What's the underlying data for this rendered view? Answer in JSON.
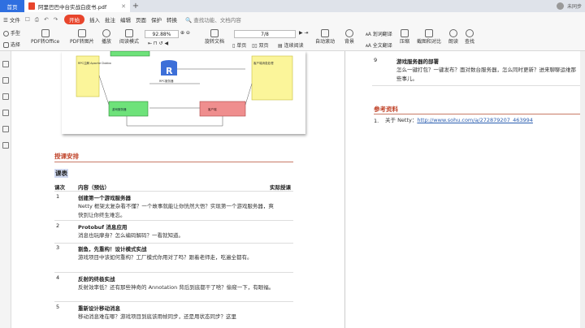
{
  "tabs": {
    "home_label": "首页",
    "doc_label": "阿里巴巴中台实战白皮书.pdf",
    "add_label": "+",
    "right_label": "未同步"
  },
  "menu": {
    "file_label": "文件",
    "quick_access": "☐ ⎙ ↶ ↷",
    "items": [
      "开始",
      "插入",
      "批注",
      "编辑",
      "页面",
      "保护",
      "转换"
    ],
    "search_placeholder": "查找功能、文档内容"
  },
  "toolbar": {
    "hand_label": "手型",
    "select_label": "选择",
    "pdf_to_office_label": "PDF转Office",
    "pdf_to_image_label": "PDF转图片",
    "play_label": "播放",
    "read_mode_label": "阅读模式",
    "zoom_value": "92.88%",
    "page_value": "7/8",
    "rotate_label": "旋转文档",
    "single_label": "单页",
    "double_label": "双页",
    "continuous_label": "连续阅读",
    "auto_scroll_label": "自动滚动",
    "background_label": "背景",
    "translate_label": "划词翻译",
    "full_translate_label": "全文翻译",
    "compress_label": "压缩",
    "screenshot_label": "截图和对比",
    "read_label": "朗读",
    "find_label": "查找"
  },
  "diagram": {
    "labels": [
      "RPC服务器",
      "游戏服务器",
      "RPC服务器",
      "客户端"
    ],
    "notes": [
      "RPC注解 Apache Dubbo",
      "客户端消息处理"
    ]
  },
  "left_page": {
    "section_title": "授课安排",
    "table_label": "课表",
    "headers": [
      "课次",
      "内容（预估）",
      "实际授课"
    ],
    "rows": [
      {
        "num": "1",
        "title": "创建第一个游戏服务器",
        "desc": "Netty 框架太复杂看不懂？一个故事就能让你恍然大悟？实现第一个游戏服务器，爽快到让你终生难忘。"
      },
      {
        "num": "2",
        "title": "Protobuf 消息应用",
        "desc": "消息也玩摩身？怎么编码解码？一看就知道。"
      },
      {
        "num": "3",
        "title": "割鱼，先重构！设计模式实战",
        "desc": "游戏项目中该如何重构？工厂模式你用对了吗？跟着老师走，吃遍全都有。"
      },
      {
        "num": "4",
        "title": "反射的终极实战",
        "desc": "反射效率低？还有那些神奇的 Annotation 背后到底都干了啥？偷窥一下，有眼福。"
      },
      {
        "num": "5",
        "title": "重新设计移动消息",
        "desc": "移动消息难在哪？游戏项目到底该用帧同步，还是用状态同步？这里"
      }
    ]
  },
  "right_page": {
    "row_num": "9",
    "row_title": "游戏服务器的部署",
    "row_desc": "怎么一键打包？一键发布？面对数台服务器，怎么同时更新？进来聊聊运维那些事儿。",
    "ref_title": "参考资料",
    "ref_num": "1.",
    "ref_prefix": "关于 Netty：",
    "ref_link": "http://www.sohu.com/a/272879207_463994"
  }
}
